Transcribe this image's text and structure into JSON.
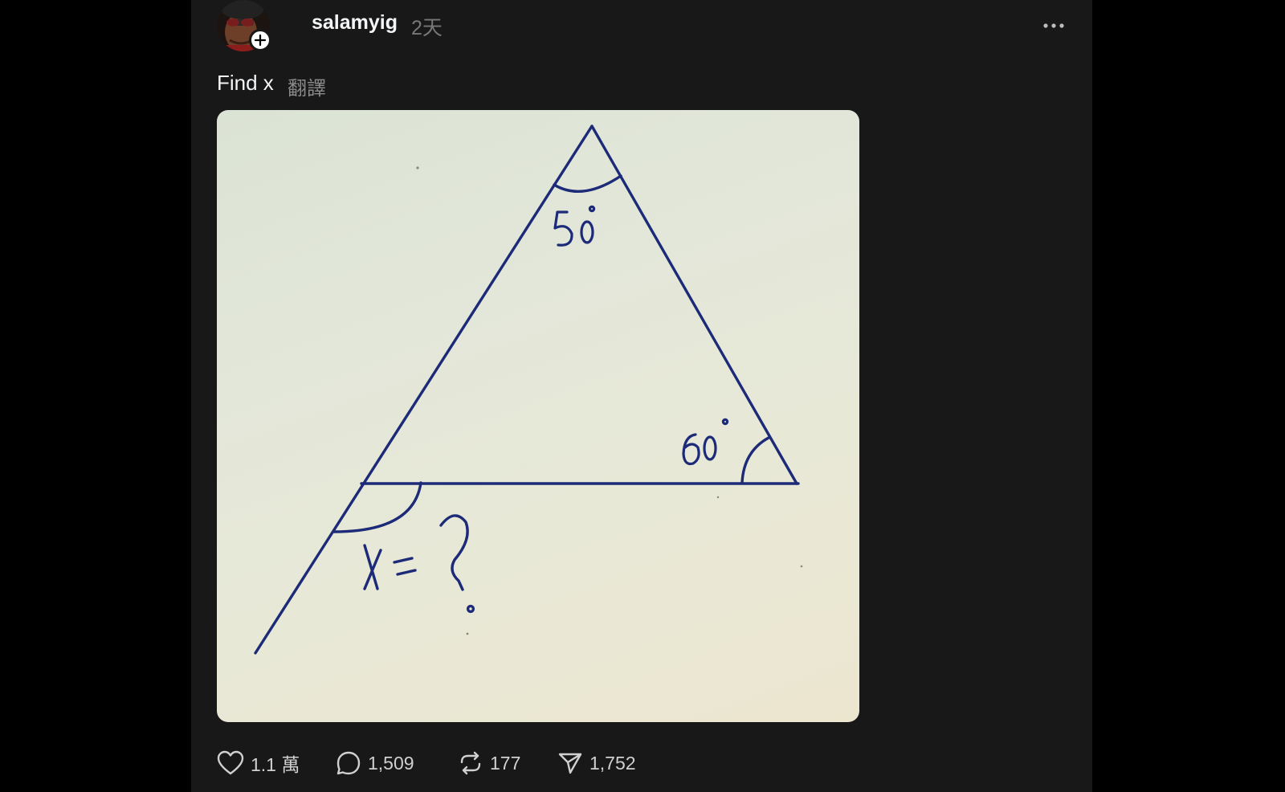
{
  "post": {
    "username": "salamyig",
    "timestamp": "2天",
    "caption": "Find x",
    "translate_label": "翻譯"
  },
  "image": {
    "angle_top": "50°",
    "angle_right": "60°",
    "question": "x = ?"
  },
  "actions": {
    "likes": "1.1 萬",
    "replies": "1,509",
    "reposts": "177",
    "shares": "1,752"
  },
  "icons": {
    "more": "more-horizontal-icon",
    "follow": "plus-icon",
    "like": "heart-icon",
    "reply": "comment-icon",
    "repost": "repost-icon",
    "share": "send-icon"
  },
  "colors": {
    "background": "#000000",
    "panel": "#181818",
    "text": "#f3f5f7",
    "muted": "#777777",
    "ink": "#1c2a78"
  }
}
